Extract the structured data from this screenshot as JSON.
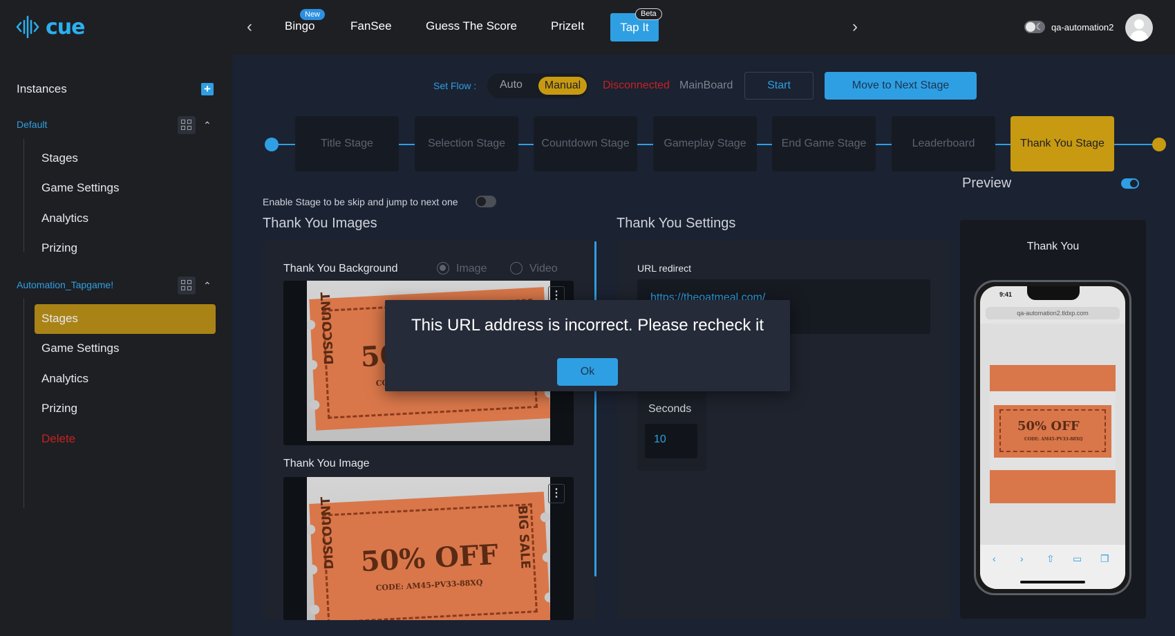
{
  "app": {
    "logo_text": "cue"
  },
  "topnav": {
    "items": [
      {
        "label": "Bingo",
        "badge": "New"
      },
      {
        "label": "FanSee"
      },
      {
        "label": "Guess The Score"
      },
      {
        "label": "PrizeIt"
      },
      {
        "label": "Tap It",
        "badge": "Beta"
      }
    ],
    "username": "qa-automation2"
  },
  "sidebar": {
    "title": "Instances",
    "groups": [
      {
        "name": "Default",
        "items": [
          "Stages",
          "Game Settings",
          "Analytics",
          "Prizing"
        ]
      },
      {
        "name": "Automation_Tapgame!",
        "items": [
          "Stages",
          "Game Settings",
          "Analytics",
          "Prizing",
          "Delete"
        ]
      }
    ]
  },
  "flow": {
    "label": "Set Flow :",
    "auto": "Auto",
    "manual": "Manual",
    "status": "Disconnected",
    "board": "MainBoard",
    "start": "Start",
    "next": "Move to Next Stage"
  },
  "stages": [
    "Title Stage",
    "Selection Stage",
    "Countdown Stage",
    "Gameplay Stage",
    "End Game Stage",
    "Leaderboard",
    "Thank You Stage"
  ],
  "skip_text": "Enable Stage to be skip and jump to next one",
  "images": {
    "title": "Thank You Images",
    "background_label": "Thank You Background",
    "radio_image": "Image",
    "radio_video": "Video",
    "image_label": "Thank You Image"
  },
  "ticket": {
    "discount": "50% OFF",
    "code": "CODE: AM45-PV33-88XQ",
    "left": "DISCOUNT",
    "right": "BIG SALE"
  },
  "settings": {
    "title": "Thank You Settings",
    "url_label": "URL redirect",
    "url_value": "https://theoatmeal.com/",
    "seconds_label": "Seconds",
    "seconds_value": "10"
  },
  "preview": {
    "title": "Preview",
    "caption": "Thank You",
    "phone_time": "9:41",
    "phone_url": "qa-automation2.tldxp.com"
  },
  "modal": {
    "message": "This URL address is incorrect. Please recheck it",
    "ok": "Ok"
  },
  "colors": {
    "accent": "#2f9fe3",
    "gold": "#c89a12",
    "danger": "#c52222"
  }
}
